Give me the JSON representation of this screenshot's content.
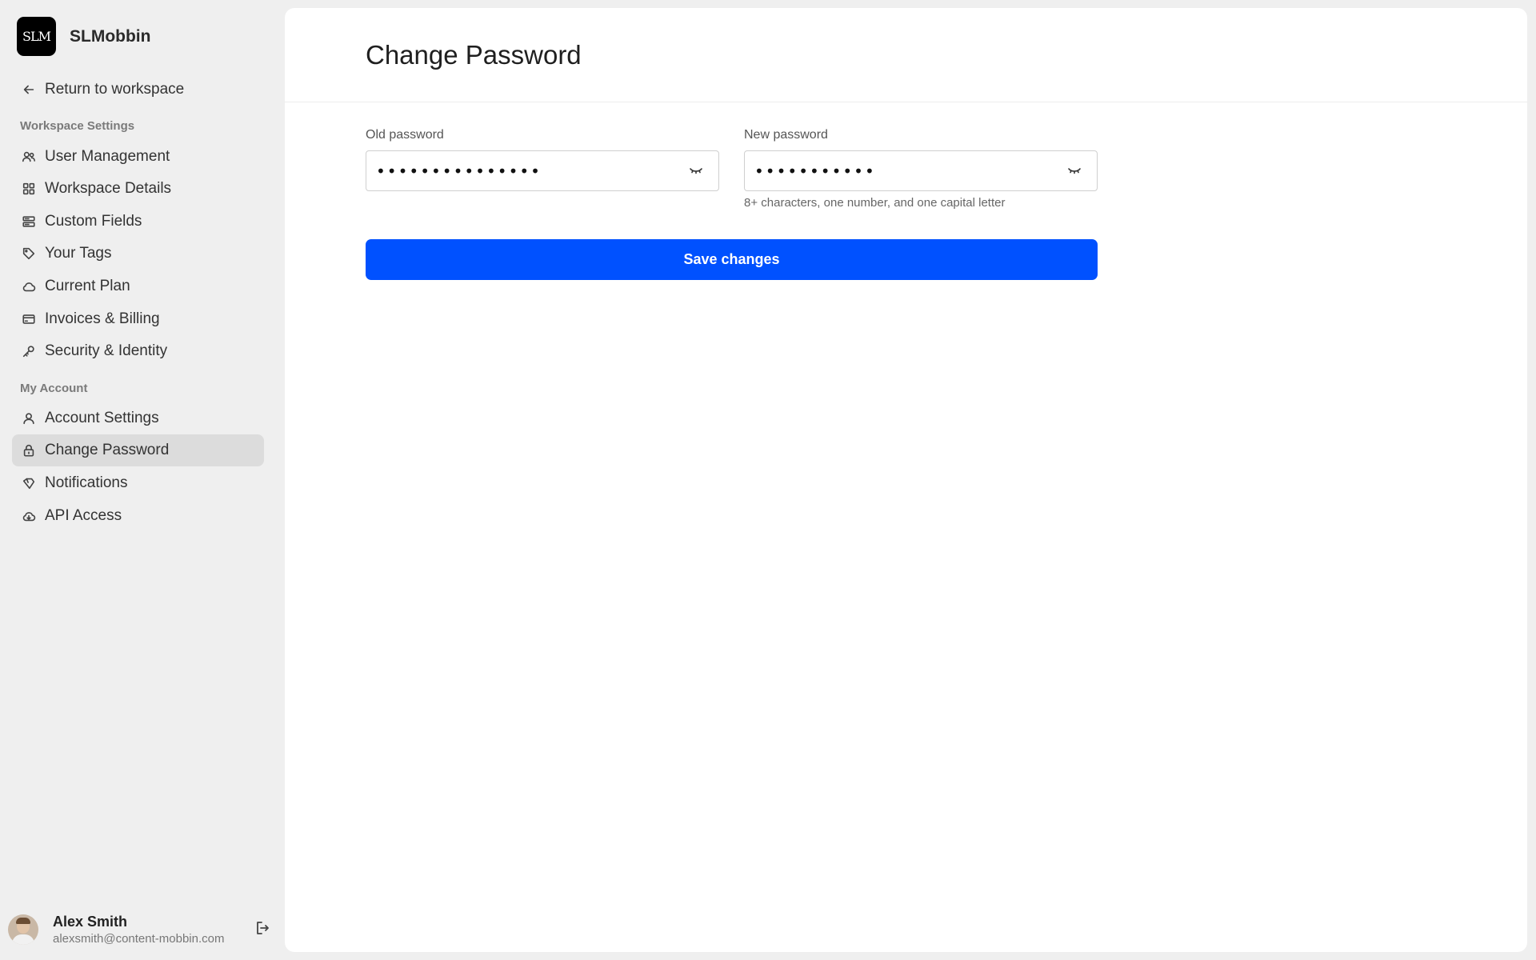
{
  "brand": {
    "logo_text": "SLM",
    "name": "SLMobbin"
  },
  "sidebar": {
    "return_label": "Return to workspace",
    "workspace_section": "Workspace Settings",
    "workspace_items": [
      {
        "label": "User Management",
        "icon": "users-icon"
      },
      {
        "label": "Workspace Details",
        "icon": "grid-icon"
      },
      {
        "label": "Custom Fields",
        "icon": "fields-icon"
      },
      {
        "label": "Your Tags",
        "icon": "tag-icon"
      },
      {
        "label": "Current Plan",
        "icon": "cloud-icon"
      },
      {
        "label": "Invoices & Billing",
        "icon": "credit-card-icon"
      },
      {
        "label": "Security & Identity",
        "icon": "key-icon"
      }
    ],
    "account_section": "My Account",
    "account_items": [
      {
        "label": "Account Settings",
        "icon": "user-icon"
      },
      {
        "label": "Change Password",
        "icon": "lock-icon",
        "active": true
      },
      {
        "label": "Notifications",
        "icon": "bell-icon"
      },
      {
        "label": "API Access",
        "icon": "cloud-download-icon"
      }
    ]
  },
  "user": {
    "name": "Alex Smith",
    "email": "alexsmith@content-mobbin.com"
  },
  "main": {
    "title": "Change Password",
    "old_password": {
      "label": "Old password",
      "value": "•••••••••••••••"
    },
    "new_password": {
      "label": "New password",
      "value": "•••••••••••",
      "hint": "8+ characters, one number, and one capital letter"
    },
    "save_label": "Save changes"
  },
  "colors": {
    "accent": "#0051ff",
    "sidebar_bg": "#efefef",
    "active_bg": "#dcdcdc"
  }
}
